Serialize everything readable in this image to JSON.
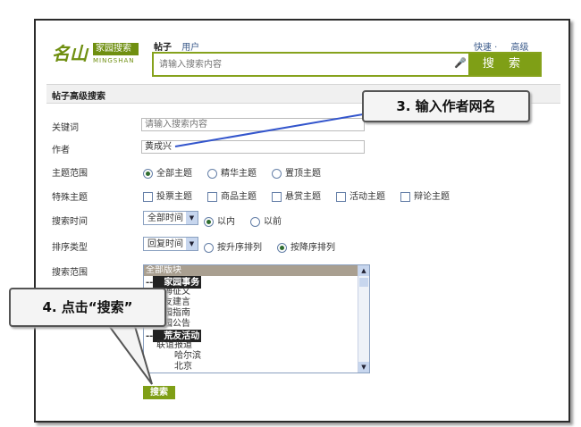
{
  "header": {
    "logo_text": "名山",
    "logo_box_text": "家园搜索",
    "logo_sub_text": "MINGSHAN",
    "tabs": [
      {
        "label": "帖子",
        "active": true
      },
      {
        "label": "用户",
        "active": false
      }
    ],
    "search": {
      "placeholder": "请输入搜索内容",
      "button_label": "搜 索"
    },
    "quick_link": "快速 ·",
    "advanced_link": "高级"
  },
  "section_title": "帖子高级搜索",
  "form": {
    "keyword": {
      "label": "关键词",
      "placeholder": "请输入搜索内容"
    },
    "author": {
      "label": "作者",
      "value": "黄成兴"
    },
    "topic_range": {
      "label": "主题范围",
      "options": [
        "全部主题",
        "精华主题",
        "置顶主题"
      ],
      "selected": "全部主题"
    },
    "special_topic": {
      "label": "特殊主题",
      "options": [
        "投票主题",
        "商品主题",
        "悬赏主题",
        "活动主题",
        "辩论主题"
      ]
    },
    "search_time": {
      "label": "搜索时间",
      "select_value": "全部时间",
      "options": [
        "以内",
        "以前"
      ],
      "selected": "以内"
    },
    "sort_type": {
      "label": "排序类型",
      "select_value": "回复时间",
      "options": [
        "按升序排列",
        "按降序排列"
      ],
      "selected": "按降序排列"
    },
    "search_range": {
      "label": "搜索范围",
      "items": [
        {
          "text": "全部版块",
          "kind": "selected"
        },
        {
          "text": "家园事务",
          "kind": "group"
        },
        {
          "text": "海征文",
          "kind": "item"
        },
        {
          "text": "友建言",
          "kind": "item"
        },
        {
          "text": "园指南",
          "kind": "item"
        },
        {
          "text": "园公告",
          "kind": "item"
        },
        {
          "text": "荒友活动",
          "kind": "group"
        },
        {
          "text": "联谊报道",
          "kind": "item"
        },
        {
          "text": "哈尔滨",
          "kind": "sub"
        },
        {
          "text": "北京",
          "kind": "sub"
        }
      ]
    },
    "submit_label": "搜索"
  },
  "callouts": {
    "step3": "3. 输入作者网名",
    "step4": "4. 点击“搜索”"
  },
  "colors": {
    "brand_green": "#7f9f16",
    "callout_line": "#3355cc"
  }
}
